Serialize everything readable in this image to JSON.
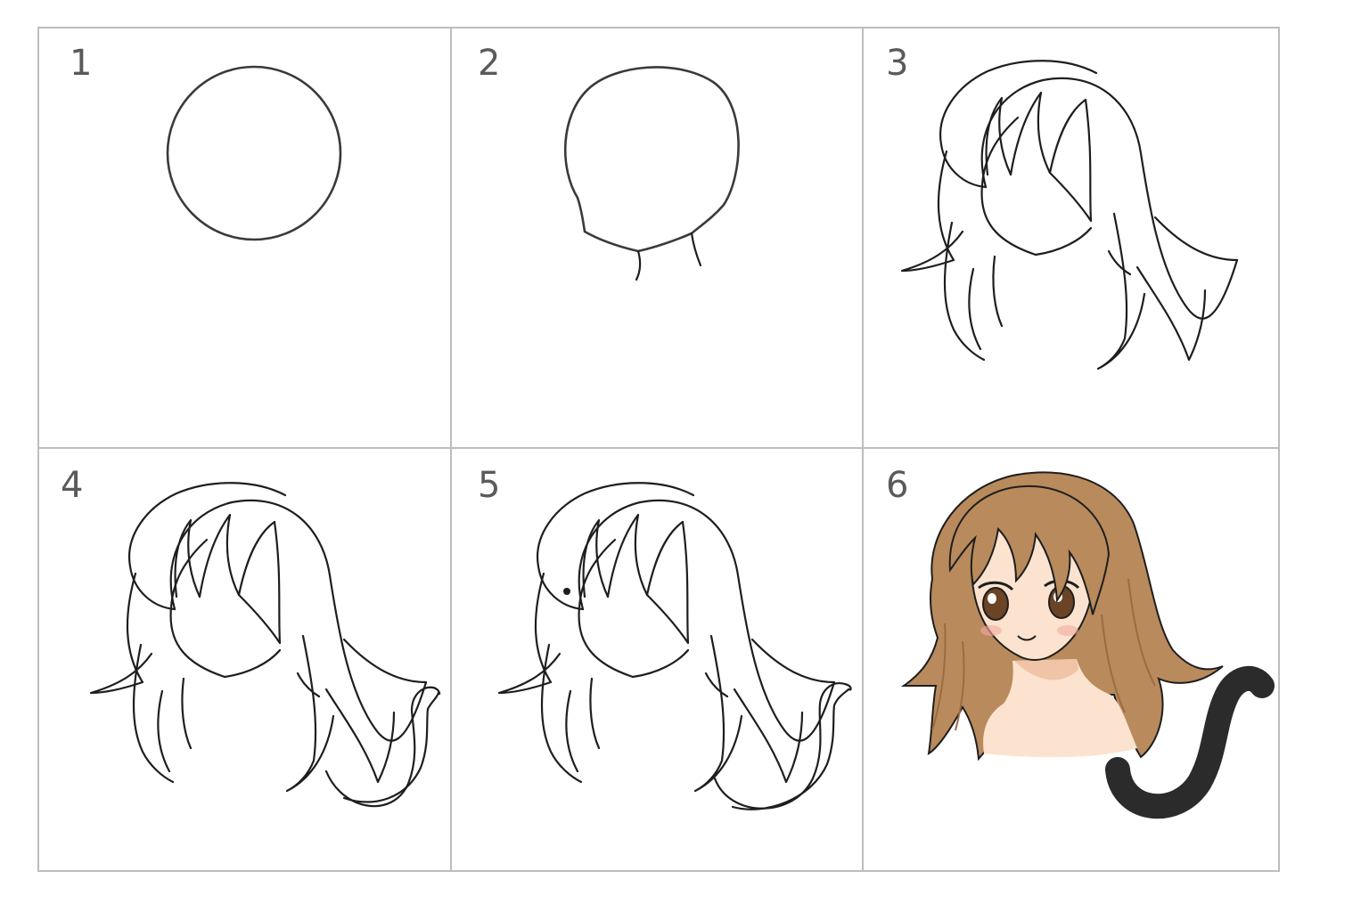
{
  "steps": [
    {
      "number": "1",
      "content": "circle"
    },
    {
      "number": "2",
      "content": "face-outline"
    },
    {
      "number": "3",
      "content": "hair-outline"
    },
    {
      "number": "4",
      "content": "hair-and-tail-outline"
    },
    {
      "number": "5",
      "content": "hair-tail-ear-outline"
    },
    {
      "number": "6",
      "content": "colored-catgirl"
    }
  ],
  "colors": {
    "grid_line": "#bdbdbd",
    "ink": "#1e1e1e",
    "number": "#5a5a5a",
    "hair": "#b98a5c",
    "hair_shade": "#9b6c43",
    "skin": "#fbe3cf",
    "skin_shade": "#f0c4a6",
    "eye": "#6b4426",
    "tail": "#2b2b2b"
  }
}
